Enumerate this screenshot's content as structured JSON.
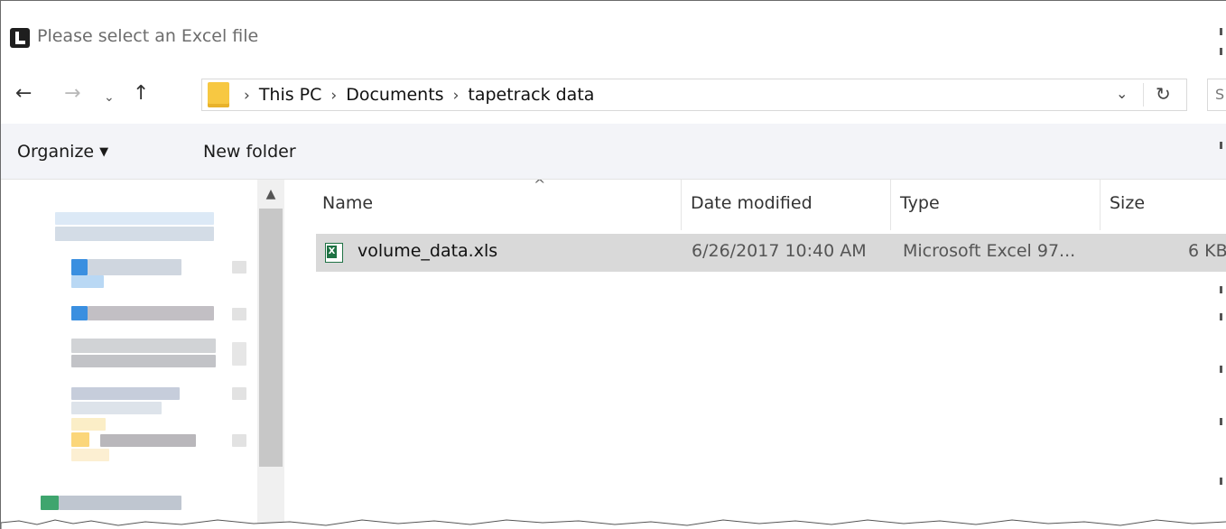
{
  "window": {
    "title": "Please select an Excel file"
  },
  "address_bar": {
    "breadcrumbs": [
      "This PC",
      "Documents",
      "tapetrack data"
    ],
    "search_stub": "S"
  },
  "toolbar": {
    "organize_label": "Organize",
    "new_folder_label": "New folder"
  },
  "file_list": {
    "columns": [
      "Name",
      "Date modified",
      "Type",
      "Size"
    ],
    "rows": [
      {
        "name": "volume_data.xls",
        "date_modified": "6/26/2017 10:40 AM",
        "type": "Microsoft Excel 97...",
        "size": "6 KB"
      }
    ]
  },
  "colors": {
    "selected_row": "#d9d9d9",
    "toolbar_bg": "#f3f4f8",
    "excel_green": "#1f7244",
    "folder_yellow": "#f7c842"
  }
}
